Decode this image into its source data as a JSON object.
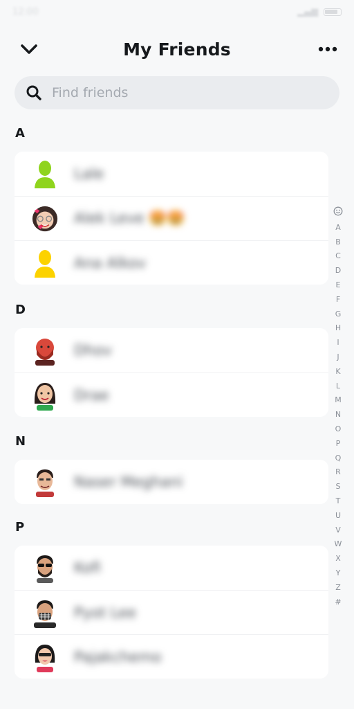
{
  "header": {
    "title": "My Friends"
  },
  "search": {
    "placeholder": "Find friends"
  },
  "icons": {
    "back": "chevron-down-icon",
    "more": "more-dots-icon",
    "search": "search-icon",
    "smiley": "smiley-icon"
  },
  "sections": [
    {
      "letter": "A",
      "friends": [
        {
          "name": "Lale",
          "avatar": "green-silhouette"
        },
        {
          "name": "Alek Leve 🤩🤩",
          "avatar": "bitmoji-girl-hearts"
        },
        {
          "name": "Ana Alkov",
          "avatar": "yellow-silhouette"
        }
      ]
    },
    {
      "letter": "D",
      "friends": [
        {
          "name": "Dhov",
          "avatar": "bitmoji-red-beard"
        },
        {
          "name": "Drae",
          "avatar": "bitmoji-woman"
        }
      ]
    },
    {
      "letter": "N",
      "friends": [
        {
          "name": "Naser Meghani",
          "avatar": "bitmoji-man"
        }
      ]
    },
    {
      "letter": "P",
      "friends": [
        {
          "name": "Kofi",
          "avatar": "bitmoji-sunglasses"
        },
        {
          "name": "Pyot Lee",
          "avatar": "bitmoji-mask"
        },
        {
          "name": "Pajakchemo",
          "avatar": "bitmoji-shades-girl"
        }
      ]
    }
  ],
  "alphabet": [
    "A",
    "B",
    "C",
    "D",
    "E",
    "F",
    "G",
    "H",
    "I",
    "J",
    "K",
    "L",
    "M",
    "N",
    "O",
    "P",
    "Q",
    "R",
    "S",
    "T",
    "U",
    "V",
    "W",
    "X",
    "Y",
    "Z",
    "#"
  ],
  "colors": {
    "background": "#f7f8f9",
    "card": "#ffffff",
    "search_bg": "#eaecef",
    "text": "#16191c",
    "muted": "#8b9098"
  }
}
